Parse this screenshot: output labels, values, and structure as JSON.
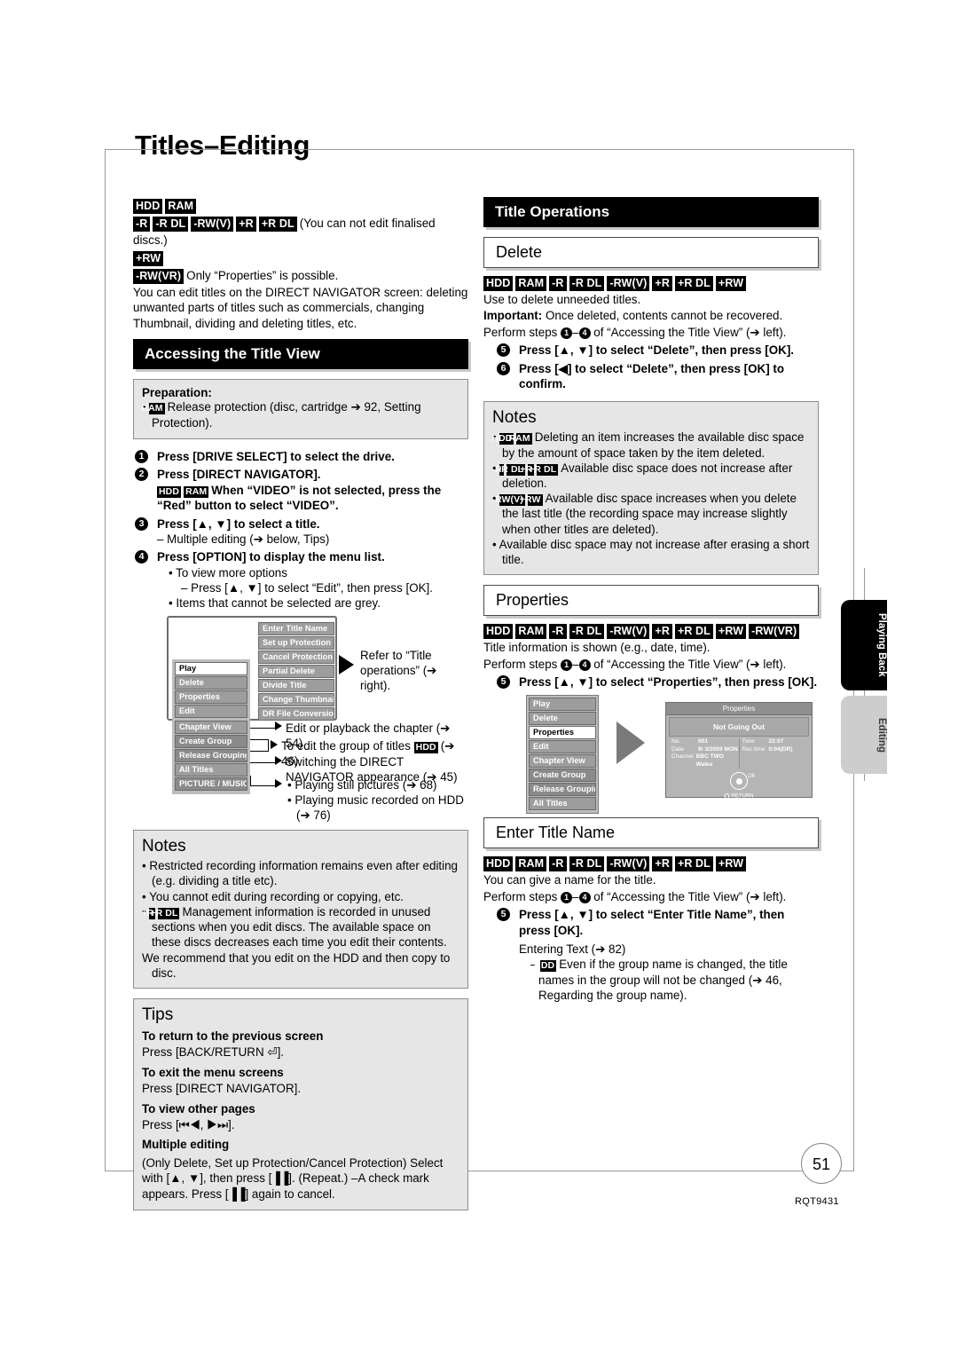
{
  "page": {
    "title": "Titles–Editing",
    "number": "51",
    "code": "RQT9431"
  },
  "side_tabs": [
    {
      "label": "Playing Back",
      "style": "dark"
    },
    {
      "label": "Editing",
      "style": "light"
    }
  ],
  "left_column": {
    "intro": {
      "badges_row1": [
        "HDD",
        "RAM"
      ],
      "badges_row2": [
        "-R",
        "-R DL",
        "-RW(V)",
        "+R",
        "+R DL"
      ],
      "row2_note": "(You can not edit finalised discs.)",
      "badges_row3": [
        "+RW"
      ],
      "badges_row4": [
        "-RW(VR)"
      ],
      "row4_note": "Only “Properties” is possible.",
      "body": "You can edit titles on the DIRECT NAVIGATOR screen: deleting unwanted parts of titles such as commercials, changing Thumbnail, dividing and deleting titles, etc."
    },
    "section_header": "Accessing the Title View",
    "preparation": {
      "title": "Preparation:",
      "badge": "RAM",
      "text": "Release protection (disc, cartridge ➔ 92, Setting Protection)."
    },
    "steps": [
      {
        "num": "1",
        "text": "Press [DRIVE SELECT] to select the drive.",
        "sub": []
      },
      {
        "num": "2",
        "text": "Press [DIRECT NAVIGATOR].",
        "badges": [
          "HDD",
          "RAM"
        ],
        "text2": "When “VIDEO” is not selected, press the “Red” button to select “VIDEO”."
      },
      {
        "num": "3",
        "text": "Press [▲, ▼] to select a title.",
        "sub": [
          "– Multiple editing (➔ below, Tips)"
        ]
      },
      {
        "num": "4",
        "text": "Press [OPTION] to display the menu list.",
        "sub_bullets": [
          "To view more options",
          "Items that cannot be selected are grey."
        ],
        "sub_dash": "– Press [▲, ▼] to select “Edit”, then press [OK]."
      }
    ],
    "diagram": {
      "menu_main": [
        "Play",
        "Delete",
        "Properties",
        "Edit"
      ],
      "menu_main_selected": "Play",
      "menu_secondary": [
        "Chapter View",
        "Create Group",
        "Release Grouping",
        "All Titles",
        "PICTURE / MUSIC"
      ],
      "submenu": [
        "Enter Title Name",
        "Set up Protection",
        "Cancel Protection",
        "Partial Delete",
        "Divide Title",
        "Change Thumbnail",
        "DR File Conversion"
      ],
      "callout_submenu": "Refer to “Title operations” (➔ right).",
      "callout_chapter": "Edit or playback the chapter (➔ 54)",
      "callout_group_pre": "To edit the group of titles",
      "callout_group_badge": "HDD",
      "callout_group_post": "(➔ 46)",
      "callout_alltitles": "Switching the DIRECT NAVIGATOR appearance (➔ 45)",
      "callout_picture": "Playing still pictures (➔ 68)",
      "callout_music": "Playing music recorded on HDD (➔ 76)"
    },
    "notes": {
      "title": "Notes",
      "items": [
        "Restricted recording information remains even after editing (e.g. dividing a title etc).",
        "You cannot edit during recording or copying, etc."
      ],
      "badged_item": {
        "badges": [
          "+R",
          "+R DL"
        ],
        "text": "Management information is recorded in unused sections when you edit discs. The available space on these discs decreases each time you edit their contents."
      },
      "tail": "We recommend that you edit on the HDD and then copy to disc."
    },
    "tips": {
      "title": "Tips",
      "entries": [
        {
          "heading": "To return to the previous screen",
          "text": "Press [BACK/RETURN ⏎]."
        },
        {
          "heading": "To exit the menu screens",
          "text": "Press [DIRECT NAVIGATOR]."
        },
        {
          "heading": "To view other pages",
          "text": "Press [⏮◀, ▶⏭]."
        },
        {
          "heading": "Multiple editing",
          "text": "(Only Delete, Set up Protection/Cancel Protection) Select with [▲, ▼], then press [▐▐]. (Repeat.) –A check mark appears. Press [▐▐] again to cancel."
        }
      ]
    }
  },
  "right_column": {
    "section_header": "Title Operations",
    "delete": {
      "heading": "Delete",
      "badges": [
        "HDD",
        "RAM",
        "-R",
        "-R DL",
        "-RW(V)",
        "+R",
        "+R DL",
        "+RW"
      ],
      "line1": "Use to delete unneeded titles.",
      "important_label": "Important:",
      "important_text": "Once deleted, contents cannot be recovered.",
      "perform_pre": "Perform steps",
      "perform_a": "1",
      "perform_b": "4",
      "perform_post": "of “Accessing the Title View” (➔ left).",
      "steps": [
        {
          "num": "5",
          "text": "Press [▲, ▼] to select “Delete”, then press [OK]."
        },
        {
          "num": "6",
          "text": "Press [◀] to select “Delete”, then press [OK] to confirm."
        }
      ]
    },
    "notes": {
      "title": "Notes",
      "items": [
        {
          "badges": [
            "HDD",
            "RAM"
          ],
          "text": "Deleting an item increases the available disc space by the amount of space taken by the item deleted."
        },
        {
          "badges": [
            "-R",
            "-R DL",
            "+R",
            "+R DL"
          ],
          "text": "Available disc space does not increase after deletion."
        },
        {
          "badges": [
            "-RW(V)",
            "+RW"
          ],
          "text": "Available disc space increases when you delete the last title (the recording space may increase slightly when other titles are deleted)."
        },
        {
          "badges": [],
          "text": "Available disc space may not increase after erasing a short title."
        }
      ]
    },
    "properties": {
      "heading": "Properties",
      "badges": [
        "HDD",
        "RAM",
        "-R",
        "-R DL",
        "-RW(V)",
        "+R",
        "+R DL",
        "+RW",
        "-RW(VR)"
      ],
      "line1": "Title information is shown (e.g., date, time).",
      "perform_pre": "Perform steps",
      "perform_a": "1",
      "perform_b": "4",
      "perform_post": "of “Accessing the Title View” (➔ left).",
      "step": {
        "num": "5",
        "text": "Press [▲, ▼] to select “Properties”, then press [OK]."
      },
      "illustration": {
        "menu": [
          "Play",
          "Delete",
          "Properties",
          "Edit",
          "Chapter View",
          "Create Group",
          "Release Grouping",
          "All Titles"
        ],
        "menu_selected": "Properties",
        "screen_title": "Properties",
        "screen_name": "Not Going Out",
        "fields_left": [
          {
            "key": "No.",
            "value": "001"
          },
          {
            "key": "Date",
            "value": "9/ 3/2009 MON"
          },
          {
            "key": "Channel",
            "value": "BBC TWO Wales"
          }
        ],
        "fields_right": [
          {
            "key": "Time",
            "value": "22:07"
          },
          {
            "key": "Rec time",
            "value": "0:04(DR)"
          }
        ],
        "ok_label": "OK",
        "return_label": "RETURN"
      }
    },
    "enter_title_name": {
      "heading": "Enter Title Name",
      "badges": [
        "HDD",
        "RAM",
        "-R",
        "-R DL",
        "-RW(V)",
        "+R",
        "+R DL",
        "+RW"
      ],
      "line1": "You can give a name for the title.",
      "perform_pre": "Perform steps",
      "perform_a": "1",
      "perform_b": "4",
      "perform_post": "of “Accessing the Title View” (➔ left).",
      "step": {
        "num": "5",
        "text": "Press [▲, ▼] to select “Enter Title Name”, then press [OK]."
      },
      "entering_text": "Entering Text (➔ 82)",
      "dash_badge": "HDD",
      "dash_text": "Even if the group name is changed, the title names in the group will not be changed (➔ 46, Regarding the group name)."
    }
  }
}
